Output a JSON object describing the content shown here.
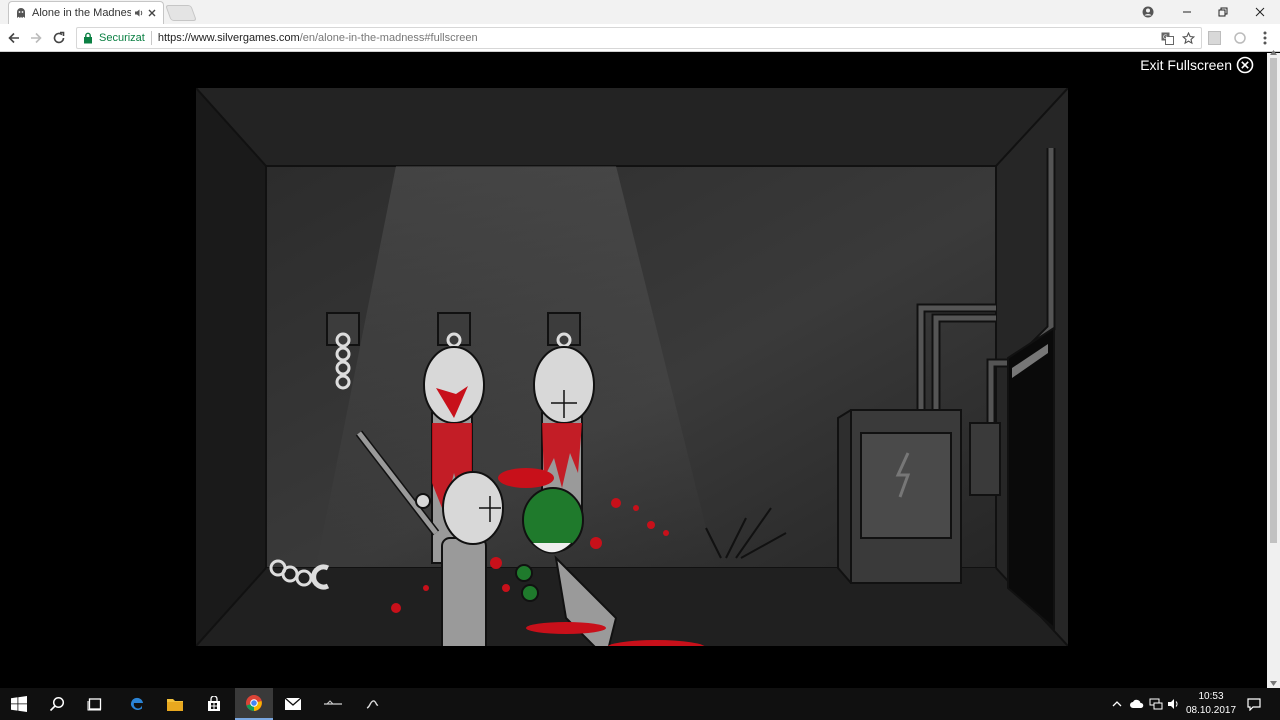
{
  "browser": {
    "tab": {
      "title": "Alone in the Madness",
      "icon": "ghost-icon"
    },
    "address": {
      "security_label": "Securizat",
      "url_host": "https://www.silvergames.com",
      "url_path": "/en/alone-in-the-madness#fullscreen"
    }
  },
  "game": {
    "exit_fullscreen_label": "Exit Fullscreen"
  },
  "taskbar": {
    "apps": [
      "start-icon",
      "search-icon",
      "task-view-icon",
      "edge-icon",
      "file-explorer-icon",
      "store-icon",
      "chrome-icon",
      "mail-icon",
      "app-icon",
      "app-icon"
    ],
    "clock": {
      "time": "10:53",
      "date": "08.10.2017"
    }
  },
  "colors": {
    "secure_green": "#0b8043",
    "taskbar_bg": "#101010",
    "blood_red": "#c8101a",
    "grunt_green": "#1f7a2c"
  }
}
